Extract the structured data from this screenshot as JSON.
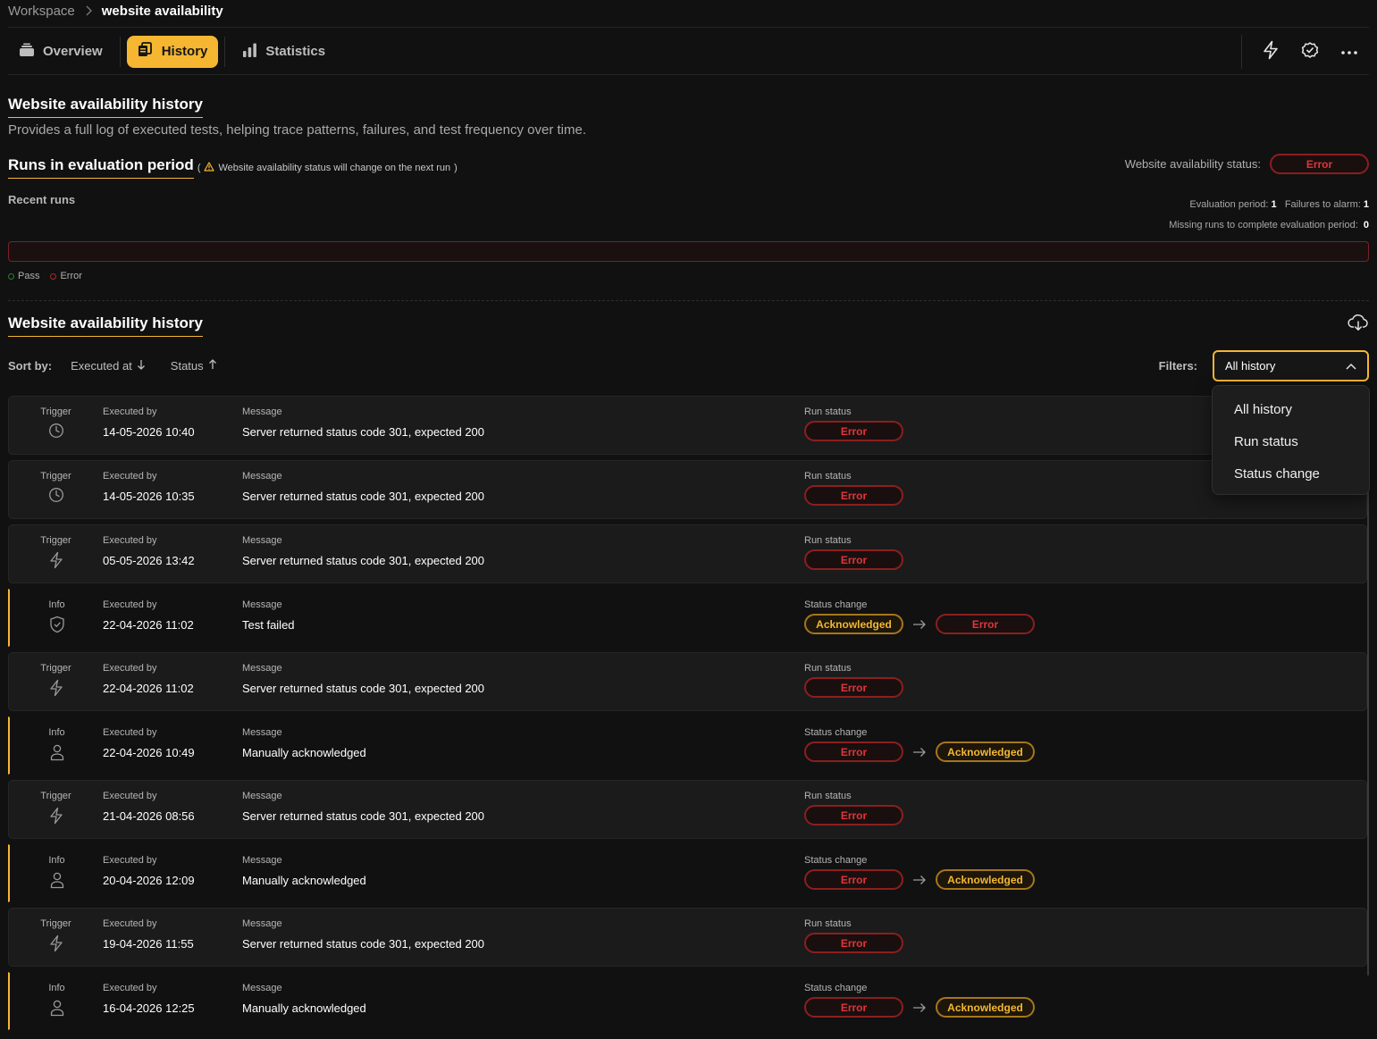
{
  "breadcrumb": {
    "root": "Workspace",
    "current": "website availability"
  },
  "tabs": [
    {
      "label": "Overview",
      "icon": "stack-icon",
      "active": false
    },
    {
      "label": "History",
      "icon": "history-icon",
      "active": true
    },
    {
      "label": "Statistics",
      "icon": "bar-chart-icon",
      "active": false
    }
  ],
  "toolbar_actions": [
    "lightning-icon",
    "check-circle-icon",
    "more-icon"
  ],
  "history_section": {
    "title": "Website availability history",
    "description": "Provides a full log of executed tests, helping trace patterns, failures, and test frequency over time."
  },
  "runs_section": {
    "title": "Runs in evaluation period",
    "note": "Website availability status will change on the next run",
    "status_label": "Website availability status:",
    "status_value": "Error",
    "recent_runs_label": "Recent runs",
    "evaluation_period_label": "Evaluation period:",
    "evaluation_period_value": "1",
    "failures_label": "Failures to alarm:",
    "failures_value": "1",
    "missing_runs_label": "Missing runs to complete evaluation period:",
    "missing_runs_value": "0",
    "legend": [
      {
        "label": "Pass",
        "color": "#2e7d32"
      },
      {
        "label": "Error",
        "color": "#b3262b"
      }
    ]
  },
  "table": {
    "title": "Website availability history",
    "sort_label": "Sort by:",
    "sort_options": [
      {
        "label": "Executed at",
        "direction": "down"
      },
      {
        "label": "Status",
        "direction": "up"
      }
    ],
    "filters_label": "Filters:",
    "filter_selected": "All history",
    "filter_options": [
      "All history",
      "Run status",
      "Status change"
    ],
    "rows": [
      {
        "type": "Trigger",
        "icon": "clock-icon",
        "executed_label": "Executed by",
        "executed": "14-05-2026 10:40",
        "message_label": "Message",
        "message": "Server returned status code 301, expected 200",
        "status_label": "Run status",
        "status": [
          "Error"
        ]
      },
      {
        "type": "Trigger",
        "icon": "clock-icon",
        "executed_label": "Executed by",
        "executed": "14-05-2026 10:35",
        "message_label": "Message",
        "message": "Server returned status code 301, expected 200",
        "status_label": "Run status",
        "status": [
          "Error"
        ]
      },
      {
        "type": "Trigger",
        "icon": "lightning-icon",
        "executed_label": "Executed by",
        "executed": "05-05-2026 13:42",
        "message_label": "Message",
        "message": "Server returned status code 301, expected 200",
        "status_label": "Run status",
        "status": [
          "Error"
        ]
      },
      {
        "type": "Info",
        "icon": "shield-icon",
        "executed_label": "Executed by",
        "executed": "22-04-2026 11:02",
        "message_label": "Message",
        "message": "Test failed",
        "status_label": "Status change",
        "status": [
          "Acknowledged",
          "Error"
        ]
      },
      {
        "type": "Trigger",
        "icon": "lightning-icon",
        "executed_label": "Executed by",
        "executed": "22-04-2026 11:02",
        "message_label": "Message",
        "message": "Server returned status code 301, expected 200",
        "status_label": "Run status",
        "status": [
          "Error"
        ]
      },
      {
        "type": "Info",
        "icon": "user-icon",
        "executed_label": "Executed by",
        "executed": "22-04-2026 10:49",
        "message_label": "Message",
        "message": "Manually acknowledged",
        "status_label": "Status change",
        "status": [
          "Error",
          "Acknowledged"
        ]
      },
      {
        "type": "Trigger",
        "icon": "lightning-icon",
        "executed_label": "Executed by",
        "executed": "21-04-2026 08:56",
        "message_label": "Message",
        "message": "Server returned status code 301, expected 200",
        "status_label": "Run status",
        "status": [
          "Error"
        ]
      },
      {
        "type": "Info",
        "icon": "user-icon",
        "executed_label": "Executed by",
        "executed": "20-04-2026 12:09",
        "message_label": "Message",
        "message": "Manually acknowledged",
        "status_label": "Status change",
        "status": [
          "Error",
          "Acknowledged"
        ]
      },
      {
        "type": "Trigger",
        "icon": "lightning-icon",
        "executed_label": "Executed by",
        "executed": "19-04-2026 11:55",
        "message_label": "Message",
        "message": "Server returned status code 301, expected 200",
        "status_label": "Run status",
        "status": [
          "Error"
        ]
      },
      {
        "type": "Info",
        "icon": "user-icon",
        "executed_label": "Executed by",
        "executed": "16-04-2026 12:25",
        "message_label": "Message",
        "message": "Manually acknowledged",
        "status_label": "Status change",
        "status": [
          "Error",
          "Acknowledged"
        ]
      }
    ]
  },
  "colors": {
    "accent": "#f5b731",
    "error": "#e0353a",
    "background": "#111111"
  }
}
